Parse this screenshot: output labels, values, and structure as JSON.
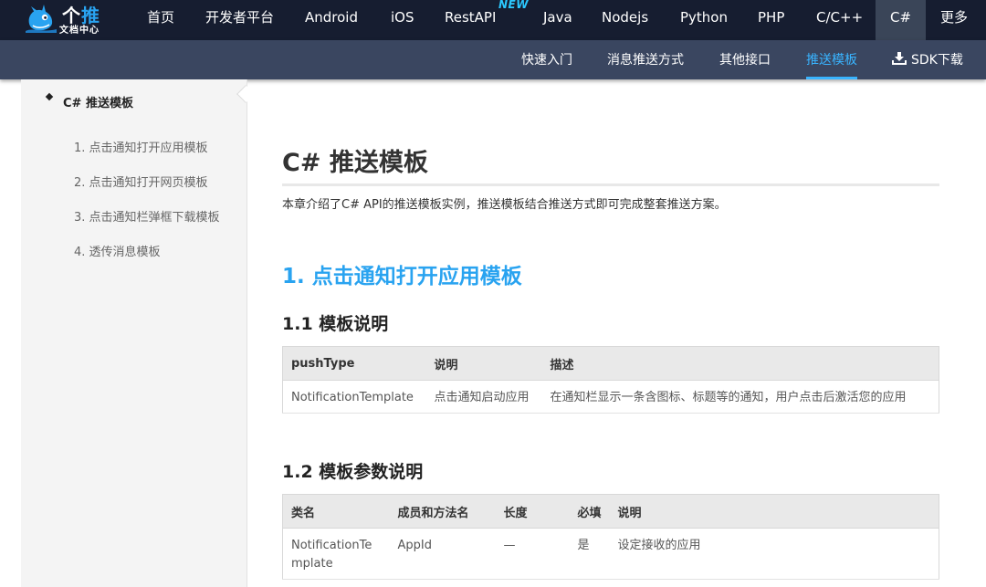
{
  "logo": {
    "title_left": "个",
    "title_right": "推",
    "subtitle": "文档中心",
    "brand_blue": "#29a3f0"
  },
  "topnav": {
    "items": [
      "首页",
      "开发者平台",
      "Android",
      "iOS",
      "RestAPI",
      "Java",
      "Nodejs",
      "Python",
      "PHP",
      "C/C++",
      "C#",
      "更多"
    ],
    "active": "C#",
    "new_badge": "NEW",
    "background": "#161d30"
  },
  "subnav": {
    "items": [
      "快速入门",
      "消息推送方式",
      "其他接口",
      "推送模板",
      "SDK下载"
    ],
    "active": "推送模板",
    "download_icon": "download-icon",
    "active_color": "#39b4ff"
  },
  "sidebar": {
    "heading": "C# 推送模板",
    "links": [
      "1. 点击通知打开应用模板",
      "2. 点击通知打开网页模板",
      "3. 点击通知栏弹框下载模板",
      "4. 透传消息模板"
    ]
  },
  "content": {
    "title": "C# 推送模板",
    "intro": "本章介绍了C# API的推送模板实例，推送模板结合推送方式即可完成整套推送方案。",
    "section1": "1. 点击通知打开应用模板",
    "sub1": "1.1 模板说明",
    "sub2": "1.2 模板参数说明"
  },
  "table1": {
    "headers": [
      "pushType",
      "说明",
      "描述"
    ],
    "rows": [
      [
        "NotificationTemplate",
        "点击通知启动应用",
        "在通知栏显示一条含图标、标题等的通知，用户点击后激活您的应用"
      ]
    ]
  },
  "table2": {
    "headers": [
      "类名",
      "成员和方法名",
      "长度",
      "必填",
      "说明"
    ],
    "rows": [
      [
        "NotificationTemplate",
        "AppId",
        "—",
        "是",
        "设定接收的应用"
      ]
    ]
  }
}
